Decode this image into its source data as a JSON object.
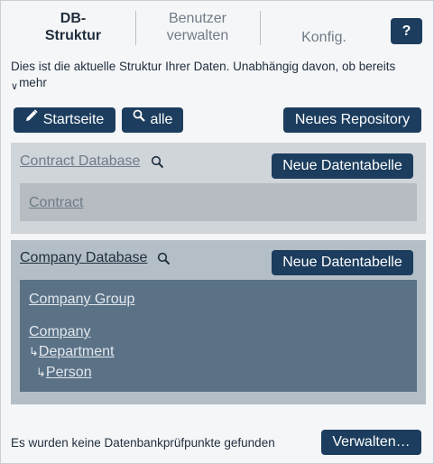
{
  "tabs": [
    {
      "label_line1": "DB-",
      "label_line2": "Struktur",
      "active": true
    },
    {
      "label_line1": "Benutzer",
      "label_line2": "verwalten",
      "active": false
    },
    {
      "label_line1": "Konfig.",
      "active": false
    }
  ],
  "help_button": "?",
  "intro_text": "Dies ist die aktuelle Struktur Ihrer Daten. Unabhängig davon, ob bereits",
  "more_link": "mehr",
  "toolbar": {
    "startseite_label": "Startseite",
    "alle_label": "alle",
    "new_repo_label": "Neues Repository"
  },
  "databases": [
    {
      "name": "Contract Database",
      "new_table_label": "Neue Datentabelle",
      "tables": [
        "Contract"
      ]
    },
    {
      "name": "Company Database",
      "new_table_label": "Neue Datentabelle",
      "tables": [
        "Company Group",
        "Company",
        "Department",
        "Person"
      ]
    }
  ],
  "footer": {
    "status_text": "Es wurden keine Datenbankprüfpunkte gefunden",
    "manage_label": "Verwalten…"
  },
  "colors": {
    "accent": "#1c3d5e",
    "panel_light": "#d0d5da",
    "panel_dark": "#b4bec6",
    "tables_dark": "#5a7186"
  },
  "icons": [
    "pencil-icon",
    "search-icon",
    "magnifier-icon",
    "tree-branch-icon"
  ]
}
